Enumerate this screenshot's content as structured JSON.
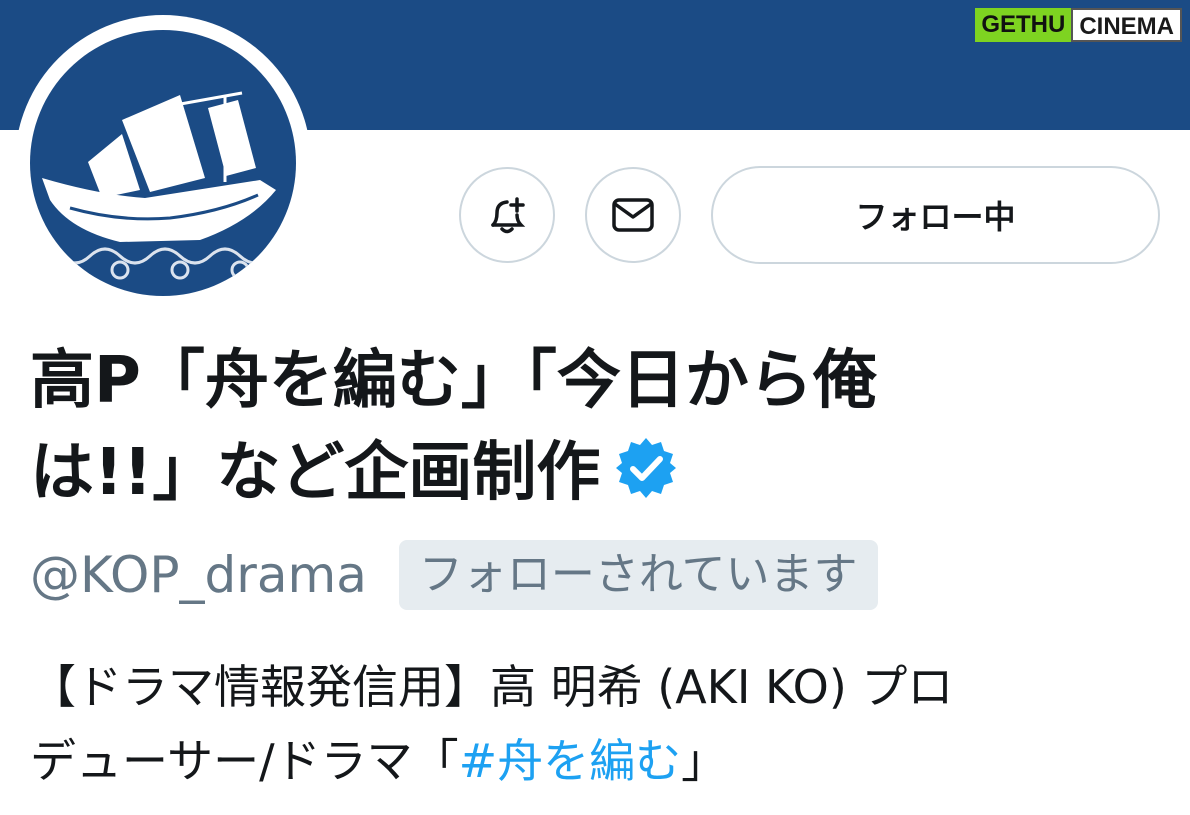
{
  "watermark": {
    "part1": "GETHU",
    "part2": "CINEMA"
  },
  "profile": {
    "avatar_icon": "ship-icon",
    "display_name_line1": "高P「舟を編む」「今日から俺",
    "display_name_line2": "は!!」など企画制作",
    "verified_icon": "verified-badge-icon",
    "handle": "@KOP_drama",
    "follows_you_badge": "フォローされています",
    "bio_line1": "【ドラマ情報発信用】高 明希 (AKI KO) プロ",
    "bio_line2_prefix": "デューサー/ドラマ「",
    "bio_hashtag": "#舟を編む",
    "bio_line2_suffix": "」"
  },
  "actions": {
    "notify_icon": "bell-plus-icon",
    "message_icon": "mail-icon",
    "following_label": "フォロー中"
  },
  "colors": {
    "banner": "#1b4b85",
    "link": "#1da1f2",
    "verified": "#1da1f2",
    "secondary_text": "#657786"
  }
}
